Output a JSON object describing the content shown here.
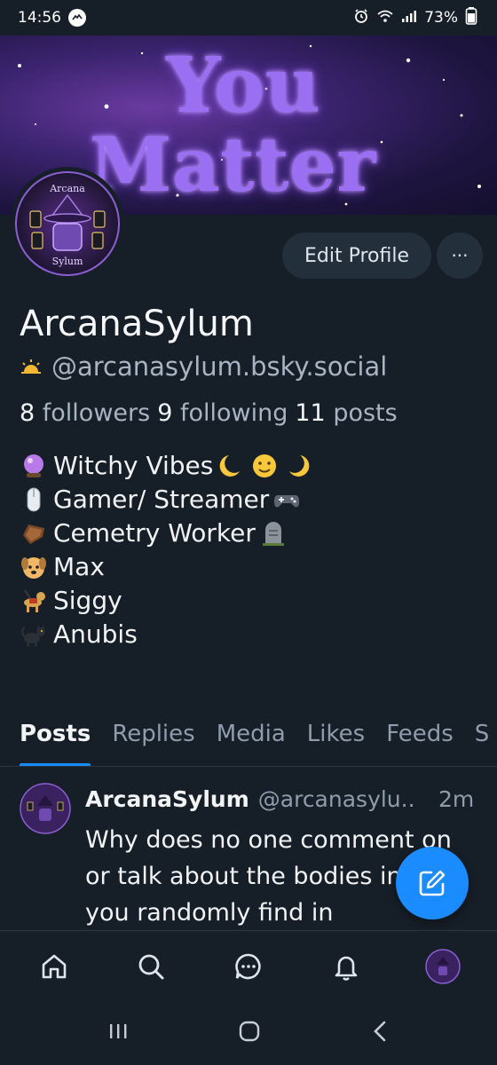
{
  "status_bar": {
    "time": "14:56",
    "battery": "73%"
  },
  "banner": {
    "line1": "You",
    "line2": "Matter"
  },
  "avatar": {
    "text_top": "Arcana",
    "text_bottom": "Sylum"
  },
  "profile": {
    "edit_label": "Edit Profile",
    "more_label": "···",
    "display_name": "ArcanaSylum",
    "handle": "@arcanasylum.bsky.social",
    "stats": {
      "followers_count": "8",
      "followers_label": "followers",
      "following_count": "9",
      "following_label": "following",
      "posts_count": "11",
      "posts_label": "posts"
    },
    "bio": [
      {
        "text": "Witchy Vibes"
      },
      {
        "text": "Gamer/ Streamer"
      },
      {
        "text": "Cemetry Worker"
      },
      {
        "text": "Max"
      },
      {
        "text": "Siggy"
      },
      {
        "text": "Anubis"
      }
    ]
  },
  "tabs": [
    "Posts",
    "Replies",
    "Media",
    "Likes",
    "Feeds",
    "S"
  ],
  "post": {
    "author": "ArcanaSylum",
    "handle": "@arcanasylu..",
    "time": "2m",
    "text": "Why does no one comment on or talk about the bodies in jars you randomly find in"
  },
  "colors": {
    "accent": "#1a8cff",
    "background": "#161e27",
    "banner_text": "#9b6ff2"
  },
  "icons": {
    "bottom_nav": [
      "home-icon",
      "search-icon",
      "chat-icon",
      "bell-icon",
      "profile-avatar"
    ],
    "fab": "compose-icon",
    "system_nav": [
      "recents-icon",
      "home-circle-icon",
      "back-icon"
    ]
  }
}
